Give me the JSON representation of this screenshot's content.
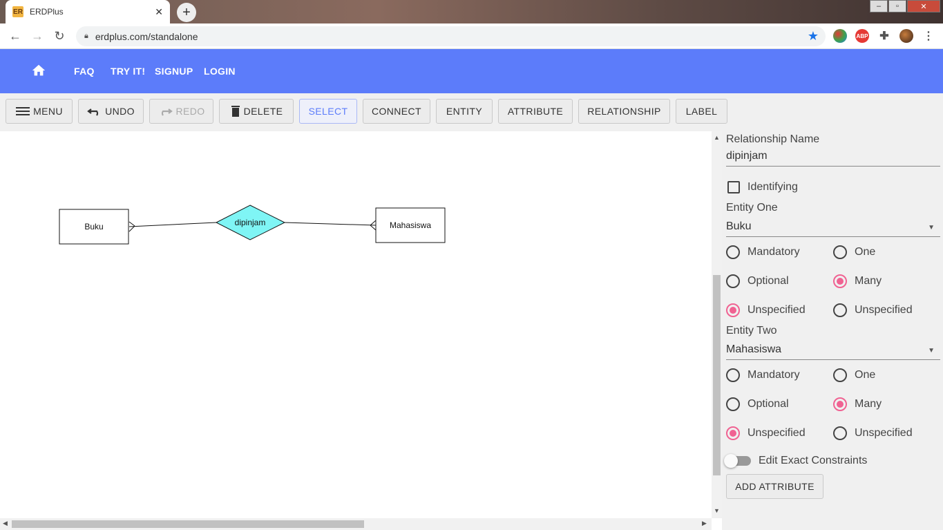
{
  "browser": {
    "tab_title": "ERDPlus",
    "favicon_text": "ER",
    "url": "erdplus.com/standalone",
    "extensions": [
      "colorful-globe-icon",
      "adblock-icon",
      "puzzle-extensions-icon",
      "profile-avatar"
    ],
    "abp_text": "ABP"
  },
  "appbar": {
    "color": "#5c7cfa",
    "links": [
      "FAQ",
      "TRY IT!",
      "SIGNUP",
      "LOGIN"
    ]
  },
  "toolbar": {
    "menu": "MENU",
    "undo": "UNDO",
    "redo": "REDO",
    "delete": "DELETE",
    "select": "SELECT",
    "connect": "CONNECT",
    "entity": "ENTITY",
    "attribute": "ATTRIBUTE",
    "relationship": "RELATIONSHIP",
    "label": "LABEL"
  },
  "diagram": {
    "entity_one": "Buku",
    "relationship": "dipinjam",
    "entity_two": "Mahasiswa",
    "relationship_color": "#7ff5f5"
  },
  "panel": {
    "relationship_name_label": "Relationship Name",
    "relationship_name_value": "dipinjam",
    "identifying_label": "Identifying",
    "identifying_checked": false,
    "entity_one_label": "Entity One",
    "entity_one_value": "Buku",
    "entity_two_label": "Entity Two",
    "entity_two_value": "Mahasiswa",
    "participation": {
      "mandatory": "Mandatory",
      "optional": "Optional",
      "unspecified": "Unspecified"
    },
    "cardinality": {
      "one": "One",
      "many": "Many",
      "unspecified": "Unspecified"
    },
    "entity_one_participation": "Unspecified",
    "entity_one_cardinality": "Many",
    "entity_two_participation": "Unspecified",
    "entity_two_cardinality": "Many",
    "edit_exact_constraints_label": "Edit Exact Constraints",
    "edit_exact_constraints_on": false,
    "add_attribute": "ADD ATTRIBUTE",
    "accent_color": "#f06292"
  }
}
